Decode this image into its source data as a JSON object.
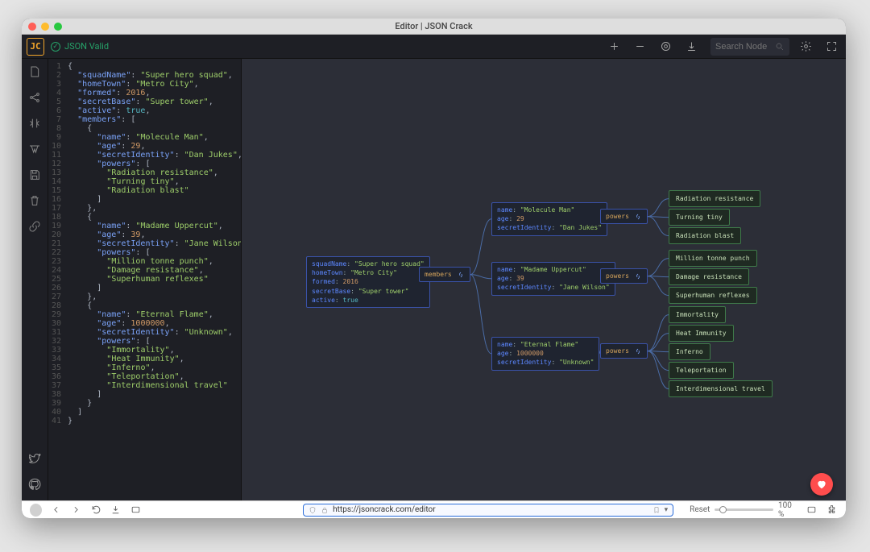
{
  "window": {
    "title": "Editor | JSON Crack"
  },
  "header": {
    "logo_text": "JC",
    "status_label": "JSON Valid",
    "search_placeholder": "Search Node"
  },
  "browser": {
    "url": "https://jsoncrack.com/editor",
    "reset_label": "Reset",
    "zoom_label": "100 %"
  },
  "code": {
    "lines": [
      "{",
      "  \"squadName\": \"Super hero squad\",",
      "  \"homeTown\": \"Metro City\",",
      "  \"formed\": 2016,",
      "  \"secretBase\": \"Super tower\",",
      "  \"active\": true,",
      "  \"members\": [",
      "    {",
      "      \"name\": \"Molecule Man\",",
      "      \"age\": 29,",
      "      \"secretIdentity\": \"Dan Jukes\",",
      "      \"powers\": [",
      "        \"Radiation resistance\",",
      "        \"Turning tiny\",",
      "        \"Radiation blast\"",
      "      ]",
      "    },",
      "    {",
      "      \"name\": \"Madame Uppercut\",",
      "      \"age\": 39,",
      "      \"secretIdentity\": \"Jane Wilson\",",
      "      \"powers\": [",
      "        \"Million tonne punch\",",
      "        \"Damage resistance\",",
      "        \"Superhuman reflexes\"",
      "      ]",
      "    },",
      "    {",
      "      \"name\": \"Eternal Flame\",",
      "      \"age\": 1000000,",
      "      \"secretIdentity\": \"Unknown\",",
      "      \"powers\": [",
      "        \"Immortality\",",
      "        \"Heat Immunity\",",
      "        \"Inferno\",",
      "        \"Teleportation\",",
      "        \"Interdimensional travel\"",
      "      ]",
      "    }",
      "  ]",
      "}"
    ]
  },
  "graph": {
    "root": {
      "rows": [
        {
          "key": "squadName",
          "type": "str",
          "value": "\"Super hero squad\""
        },
        {
          "key": "homeTown",
          "type": "str",
          "value": "\"Metro City\""
        },
        {
          "key": "formed",
          "type": "num",
          "value": "2016"
        },
        {
          "key": "secretBase",
          "type": "str",
          "value": "\"Super tower\""
        },
        {
          "key": "active",
          "type": "boo",
          "value": "true"
        }
      ]
    },
    "members_label": "members",
    "powers_label": "powers",
    "members": [
      {
        "rows": [
          {
            "key": "name",
            "type": "str",
            "value": "\"Molecule Man\""
          },
          {
            "key": "age",
            "type": "num",
            "value": "29"
          },
          {
            "key": "secretIdentity",
            "type": "str",
            "value": "\"Dan Jukes\""
          }
        ],
        "powers": [
          "Radiation resistance",
          "Turning tiny",
          "Radiation blast"
        ]
      },
      {
        "rows": [
          {
            "key": "name",
            "type": "str",
            "value": "\"Madame Uppercut\""
          },
          {
            "key": "age",
            "type": "num",
            "value": "39"
          },
          {
            "key": "secretIdentity",
            "type": "str",
            "value": "\"Jane Wilson\""
          }
        ],
        "powers": [
          "Million tonne punch",
          "Damage resistance",
          "Superhuman reflexes"
        ]
      },
      {
        "rows": [
          {
            "key": "name",
            "type": "str",
            "value": "\"Eternal Flame\""
          },
          {
            "key": "age",
            "type": "num",
            "value": "1000000"
          },
          {
            "key": "secretIdentity",
            "type": "str",
            "value": "\"Unknown\""
          }
        ],
        "powers": [
          "Immortality",
          "Heat Immunity",
          "Inferno",
          "Teleportation",
          "Interdimensional travel"
        ]
      }
    ]
  }
}
